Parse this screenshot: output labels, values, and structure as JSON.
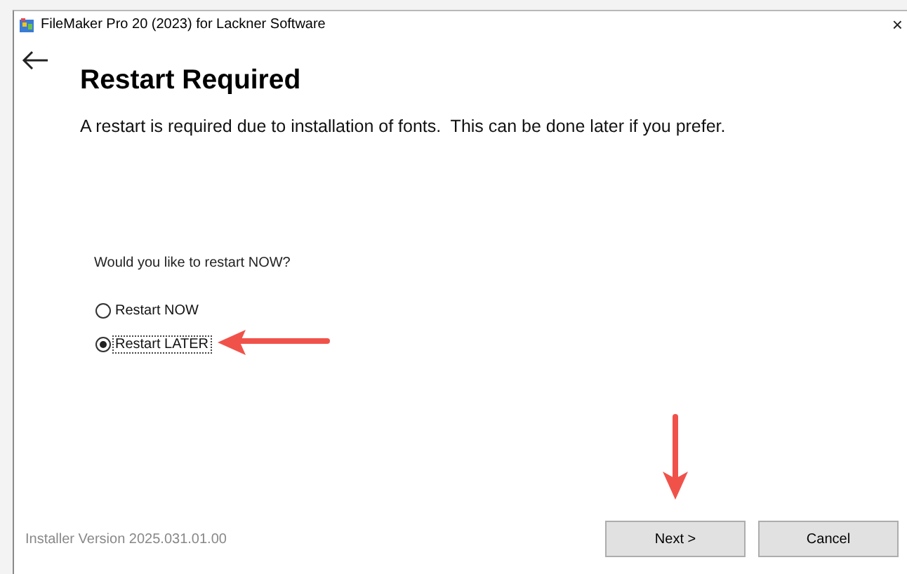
{
  "window": {
    "title": "FileMaker Pro 20 (2023) for Lackner Software",
    "close": "×"
  },
  "heading": "Restart Required",
  "message": "A restart is required due to installation of fonts.  This can be done later if you prefer.",
  "question": "Would you like to restart NOW?",
  "options": [
    {
      "label": "Restart NOW",
      "selected": false
    },
    {
      "label": "Restart LATER",
      "selected": true
    }
  ],
  "version": "Installer Version 2025.031.01.00",
  "buttons": [
    {
      "label": "Next >"
    },
    {
      "label": "Cancel"
    }
  ]
}
